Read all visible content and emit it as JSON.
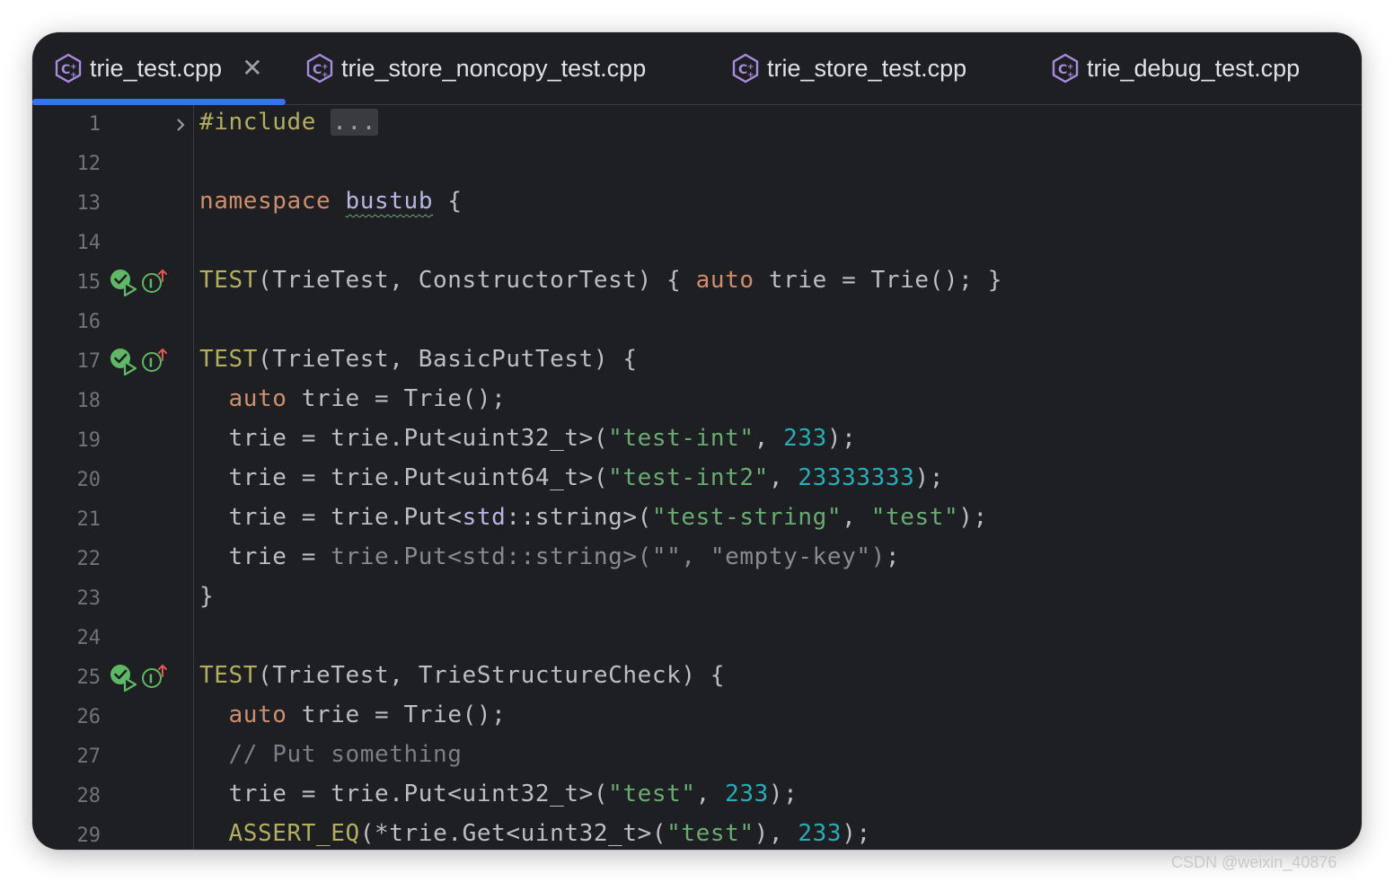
{
  "tabs": [
    {
      "label": "trie_test.cpp",
      "active": true,
      "closable": true,
      "close_glyph": "✕"
    },
    {
      "label": "trie_store_noncopy_test.cpp",
      "active": false
    },
    {
      "label": "trie_store_test.cpp",
      "active": false
    },
    {
      "label": "trie_debug_test.cpp",
      "active": false
    }
  ],
  "tab_icon": "cpp-file-icon",
  "colors": {
    "background": "#1e1f22",
    "accent": "#3574f0",
    "keyword": "#cf8e6d",
    "macro": "#b3ae60",
    "string": "#6aab73",
    "number": "#2aacb8",
    "namespace": "#b5b6e3",
    "comment": "#7a7e85",
    "text": "#bcbec4",
    "line_number": "#6f737a"
  },
  "editor": {
    "lines": [
      {
        "n": "1",
        "folded": true,
        "tokens": [
          {
            "t": "#include",
            "c": "macro"
          },
          {
            "t": " "
          },
          {
            "t": "...",
            "c": "folded-box"
          }
        ]
      },
      {
        "n": "12",
        "tokens": []
      },
      {
        "n": "13",
        "tokens": [
          {
            "t": "namespace",
            "c": "kw"
          },
          {
            "t": " "
          },
          {
            "t": "bustub",
            "c": "ns squig"
          },
          {
            "t": " {"
          }
        ]
      },
      {
        "n": "14",
        "tokens": []
      },
      {
        "n": "15",
        "test_icons": true,
        "tokens": [
          {
            "t": "TEST",
            "c": "macro"
          },
          {
            "t": "(TrieTest, ConstructorTest) { "
          },
          {
            "t": "auto",
            "c": "kw"
          },
          {
            "t": " trie = Trie(); }"
          }
        ]
      },
      {
        "n": "16",
        "tokens": []
      },
      {
        "n": "17",
        "test_icons": true,
        "tokens": [
          {
            "t": "TEST",
            "c": "macro"
          },
          {
            "t": "(TrieTest, BasicPutTest) {"
          }
        ]
      },
      {
        "n": "18",
        "tokens": [
          {
            "t": "  "
          },
          {
            "t": "auto",
            "c": "kw"
          },
          {
            "t": " trie = Trie();"
          }
        ]
      },
      {
        "n": "19",
        "tokens": [
          {
            "t": "  trie = trie.Put<uint32_t>("
          },
          {
            "t": "\"test-int\"",
            "c": "str"
          },
          {
            "t": ", "
          },
          {
            "t": "233",
            "c": "num"
          },
          {
            "t": ");"
          }
        ]
      },
      {
        "n": "20",
        "tokens": [
          {
            "t": "  trie = trie.Put<uint64_t>("
          },
          {
            "t": "\"test-int2\"",
            "c": "str"
          },
          {
            "t": ", "
          },
          {
            "t": "23333333",
            "c": "num"
          },
          {
            "t": ");"
          }
        ]
      },
      {
        "n": "21",
        "tokens": [
          {
            "t": "  trie = trie.Put<"
          },
          {
            "t": "std",
            "c": "ns"
          },
          {
            "t": "::string>("
          },
          {
            "t": "\"test-string\"",
            "c": "str"
          },
          {
            "t": ", "
          },
          {
            "t": "\"test\"",
            "c": "str"
          },
          {
            "t": ");"
          }
        ]
      },
      {
        "n": "22",
        "tokens": [
          {
            "t": "  trie = "
          },
          {
            "t": "trie.Put<std::string>(\"\", \"empty-key\")",
            "c": "dim"
          },
          {
            "t": ";"
          }
        ]
      },
      {
        "n": "23",
        "tokens": [
          {
            "t": "}"
          }
        ]
      },
      {
        "n": "24",
        "tokens": []
      },
      {
        "n": "25",
        "test_icons": true,
        "tokens": [
          {
            "t": "TEST",
            "c": "macro"
          },
          {
            "t": "(TrieTest, TrieStructureCheck) {"
          }
        ]
      },
      {
        "n": "26",
        "tokens": [
          {
            "t": "  "
          },
          {
            "t": "auto",
            "c": "kw"
          },
          {
            "t": " trie = Trie();"
          }
        ]
      },
      {
        "n": "27",
        "tokens": [
          {
            "t": "  // Put something",
            "c": "cmt"
          }
        ]
      },
      {
        "n": "28",
        "tokens": [
          {
            "t": "  trie = trie.Put<uint32_t>("
          },
          {
            "t": "\"test\"",
            "c": "str"
          },
          {
            "t": ", "
          },
          {
            "t": "233",
            "c": "num"
          },
          {
            "t": ");"
          }
        ]
      },
      {
        "n": "29",
        "tokens": [
          {
            "t": "  "
          },
          {
            "t": "ASSERT_EQ",
            "c": "macro"
          },
          {
            "t": "(*trie.Get<uint32_t>("
          },
          {
            "t": "\"test\"",
            "c": "str"
          },
          {
            "t": "), "
          },
          {
            "t": "233",
            "c": "num"
          },
          {
            "t": ");"
          }
        ]
      }
    ]
  },
  "watermark": "CSDN @weixin_40876"
}
